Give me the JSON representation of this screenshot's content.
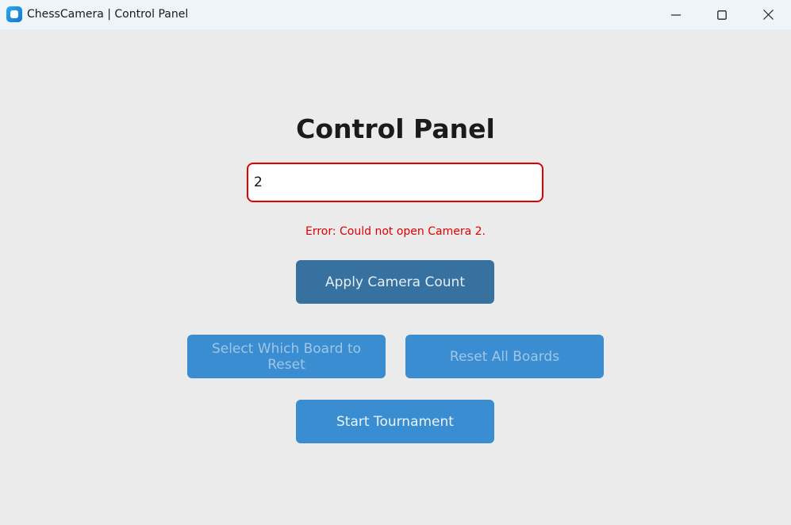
{
  "window": {
    "title": "ChessCamera | Control Panel",
    "controls": {
      "minimize_icon": "minimize-icon",
      "maximize_icon": "maximize-icon",
      "close_icon": "close-icon"
    }
  },
  "panel": {
    "heading": "Control Panel",
    "camera_input": {
      "value": "2",
      "placeholder": ""
    },
    "error_message": "Error: Could not open Camera 2.",
    "buttons": {
      "apply_camera_count": "Apply Camera Count",
      "select_board_reset": "Select Which Board to Reset",
      "reset_all_boards": "Reset All Boards",
      "start_tournament": "Start Tournament"
    }
  },
  "colors": {
    "background": "#ebebeb",
    "titlebar": "#eef4f7",
    "error": "#e00000",
    "button_primary": "#3a8dd0",
    "button_hover": "#36719f"
  }
}
